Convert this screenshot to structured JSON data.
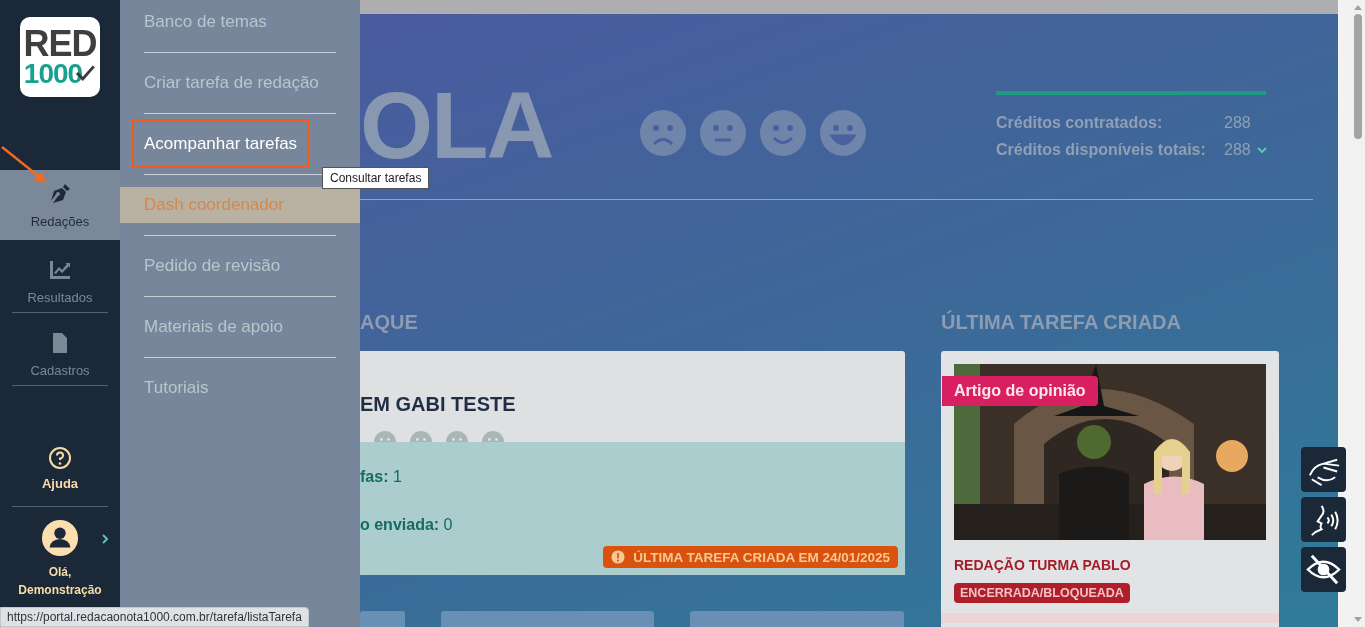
{
  "logo": {
    "line_1": "RED",
    "line_2": "1000"
  },
  "sidebar": {
    "items": [
      {
        "label": "Redações",
        "selected": true
      },
      {
        "label": "Resultados",
        "selected": false
      },
      {
        "label": "Cadastros",
        "selected": false
      }
    ],
    "help": "Ajuda",
    "user": "Olá, Demonstração"
  },
  "submenu": {
    "items": [
      {
        "label": "Banco de temas",
        "selected": false,
        "outlined": false
      },
      {
        "label": "Criar tarefa de redação",
        "selected": false,
        "outlined": false
      },
      {
        "label": "Acompanhar tarefas",
        "selected": false,
        "outlined": true
      },
      {
        "label": "Dash coordenador",
        "selected": true,
        "outlined": false
      },
      {
        "label": "Pedido de revisão",
        "selected": false,
        "outlined": false
      },
      {
        "label": "Materiais de apoio",
        "selected": false,
        "outlined": false
      },
      {
        "label": "Tutoriais",
        "selected": false,
        "outlined": false
      }
    ]
  },
  "tooltip": "Consultar tarefas",
  "status_url": "https://portal.redacaonota1000.com.br/tarefa/listaTarefa",
  "hero": {
    "title": "OLA",
    "credits": [
      {
        "label": "Créditos contratados:",
        "value": "288",
        "expandable": false
      },
      {
        "label": "Créditos disponíveis totais:",
        "value": "288",
        "expandable": true
      }
    ]
  },
  "highlight": {
    "heading": "AQUE",
    "card_title": "EM GABI TESTE",
    "stats": [
      {
        "label": "fas:",
        "value": "1"
      },
      {
        "label": "o enviada:",
        "value": "0"
      }
    ],
    "badge": "ÚLTIMA TAREFA CRIADA EM 24/01/2025"
  },
  "last_task": {
    "heading": "ÚLTIMA TAREFA CRIADA",
    "tag": "Artigo de opinião",
    "title": "REDAÇÃO TURMA PABLO",
    "status": "ENCERRADA/BLOQUEADA"
  }
}
